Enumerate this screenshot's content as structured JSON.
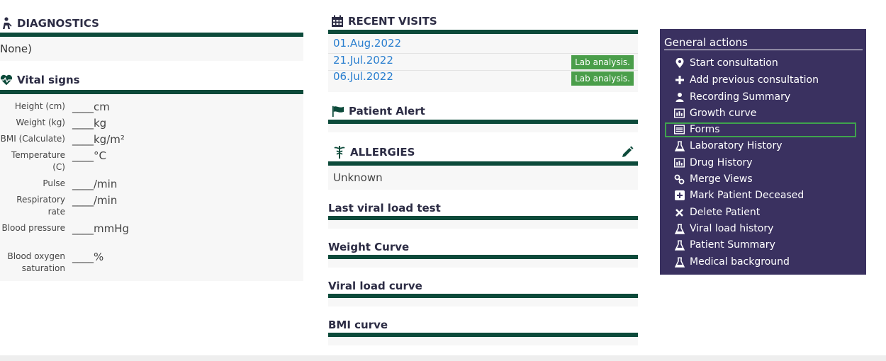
{
  "diagnostics": {
    "title": "DIAGNOSTICS",
    "value": "None)"
  },
  "vital_signs": {
    "title": "Vital signs",
    "rows": [
      {
        "label": "Height (cm)",
        "value": "____cm"
      },
      {
        "label": "Weight (kg)",
        "value": "____kg"
      },
      {
        "label": "BMI (Calculate)",
        "value": "____kg/m²"
      },
      {
        "label": "Temperature (C)",
        "value": "____°C"
      },
      {
        "label": "Pulse",
        "value": "____/min"
      },
      {
        "label": "Respiratory rate",
        "value": "____/min"
      },
      {
        "label": "Blood pressure",
        "value": "____mmHg"
      },
      {
        "label": "Blood oxygen saturation",
        "value": "____%"
      }
    ]
  },
  "recent_visits": {
    "title": "RECENT VISITS",
    "visits": [
      {
        "date": "01.Aug.2022",
        "badge": ""
      },
      {
        "date": "21.Jul.2022",
        "badge": "Lab analysis."
      },
      {
        "date": "06.Jul.2022",
        "badge": "Lab analysis."
      }
    ]
  },
  "patient_alert": {
    "title": "Patient Alert"
  },
  "allergies": {
    "title": "ALLERGIES",
    "value": "Unknown"
  },
  "sections": {
    "last_viral_load": "Last viral load test",
    "weight_curve": "Weight Curve",
    "viral_load_curve": "Viral load curve",
    "bmi_curve": "BMI curve"
  },
  "general_actions": {
    "title": "General actions",
    "items": [
      {
        "label": "Start consultation",
        "icon": "map-pin-icon"
      },
      {
        "label": "Add previous consultation",
        "icon": "plus-icon"
      },
      {
        "label": "Recording Summary",
        "icon": "user-icon"
      },
      {
        "label": "Growth curve",
        "icon": "bar-chart-icon"
      },
      {
        "label": "Forms",
        "icon": "list-icon"
      },
      {
        "label": "Laboratory History",
        "icon": "flask-icon"
      },
      {
        "label": "Drug History",
        "icon": "bar-chart-icon"
      },
      {
        "label": "Merge Views",
        "icon": "link-icon"
      },
      {
        "label": "Mark Patient Deceased",
        "icon": "plus-square-icon"
      },
      {
        "label": "Delete Patient",
        "icon": "close-icon"
      },
      {
        "label": "Viral load history",
        "icon": "flask-icon"
      },
      {
        "label": "Patient Summary",
        "icon": "flask-icon"
      },
      {
        "label": "Medical background",
        "icon": "flask-icon"
      }
    ],
    "highlighted": "Forms"
  },
  "colors": {
    "section_bar": "#0c4a3a",
    "panel_bg": "#3a3160",
    "link": "#2a7fcf",
    "badge": "#4a9e4a",
    "highlight": "#3fa34d"
  }
}
